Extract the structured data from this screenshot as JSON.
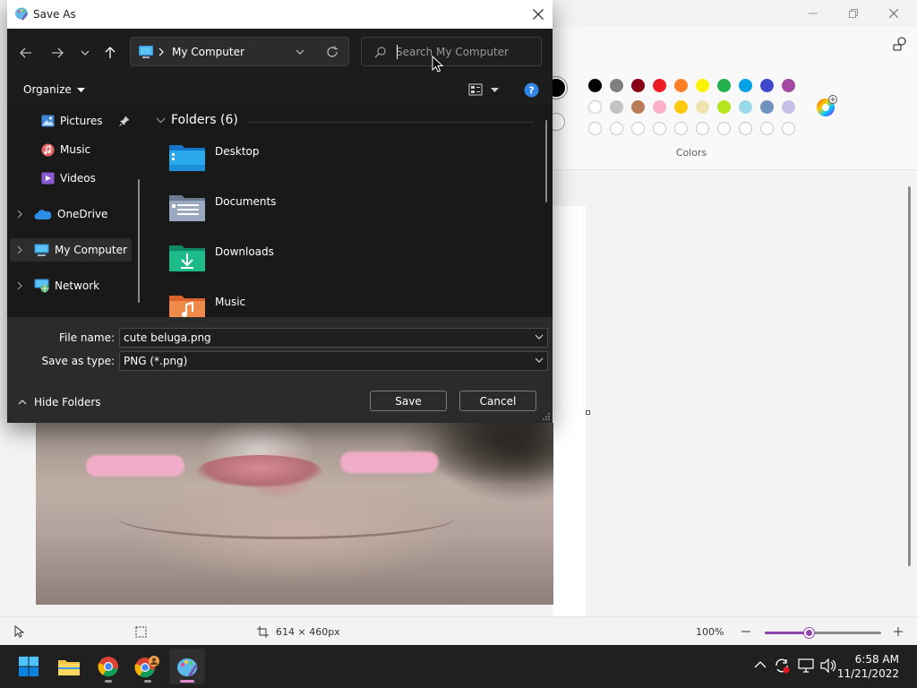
{
  "dialog": {
    "title": "Save As",
    "address": "My Computer",
    "search_placeholder": "Search My Computer",
    "organize_label": "Organize",
    "nav_items": [
      {
        "label": "Pictures",
        "icon": "pictures-icon",
        "pinned": true
      },
      {
        "label": "Music",
        "icon": "music-icon"
      },
      {
        "label": "Videos",
        "icon": "videos-icon"
      },
      {
        "label": "OneDrive",
        "icon": "onedrive-icon"
      },
      {
        "label": "My Computer",
        "icon": "computer-icon",
        "selected": true
      },
      {
        "label": "Network",
        "icon": "network-icon"
      }
    ],
    "folders_header": "Folders (6)",
    "folders": [
      {
        "name": "Desktop",
        "icon": "desktop-folder-icon"
      },
      {
        "name": "Documents",
        "icon": "documents-folder-icon"
      },
      {
        "name": "Downloads",
        "icon": "downloads-folder-icon"
      },
      {
        "name": "Music",
        "icon": "music-folder-icon"
      }
    ],
    "file_name_label": "File name:",
    "file_name_value": "cute beluga.png",
    "save_type_label": "Save as type:",
    "save_type_value": "PNG (*.png)",
    "hide_folders_label": "Hide Folders",
    "save_button": "Save",
    "cancel_button": "Cancel"
  },
  "paint": {
    "colors_label": "Colors",
    "palette_row1": [
      "#000000",
      "#7f7f7f",
      "#880015",
      "#ed1c24",
      "#ff7f27",
      "#fff200",
      "#22b14c",
      "#00a2e8",
      "#3f48cc",
      "#a349a4"
    ],
    "palette_row2": [
      "#ffffff",
      "#c3c3c3",
      "#b97a57",
      "#ffaec9",
      "#ffc90e",
      "#efe4b0",
      "#b5e61d",
      "#99d9ea",
      "#7092be",
      "#c8bfe7"
    ],
    "palette_row3_count": 10,
    "canvas_size": "614 × 460px",
    "zoom": "100%",
    "zoom_fraction": 0.38
  },
  "taskbar": {
    "apps": [
      "windows-start-icon",
      "file-explorer-icon",
      "chrome-icon",
      "chrome-profile-icon",
      "paint-icon"
    ],
    "time": "6:58 AM",
    "date": "11/21/2022"
  },
  "accent_color": "#8e44ad"
}
